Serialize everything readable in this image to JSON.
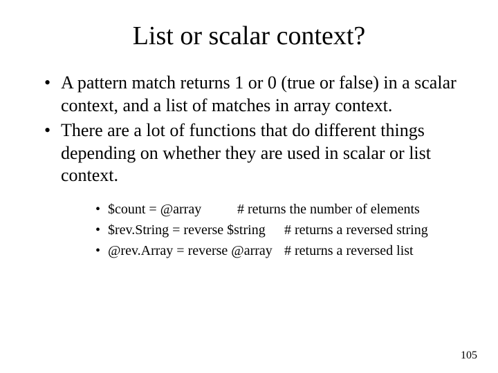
{
  "title": "List or scalar context?",
  "bullets": {
    "main": [
      "A pattern match returns 1 or 0 (true or false) in a scalar context, and a list of matches in array context.",
      "There are a lot of functions that do different things depending on whether they are used in scalar or list context."
    ],
    "sub": [
      {
        "code": "$count = @array",
        "comment": "# returns the number of elements"
      },
      {
        "code": "$rev.String = reverse $string",
        "comment": "# returns a reversed string"
      },
      {
        "code": "@rev.Array = reverse @array",
        "comment": "# returns a reversed list"
      }
    ]
  },
  "page_number": "105"
}
